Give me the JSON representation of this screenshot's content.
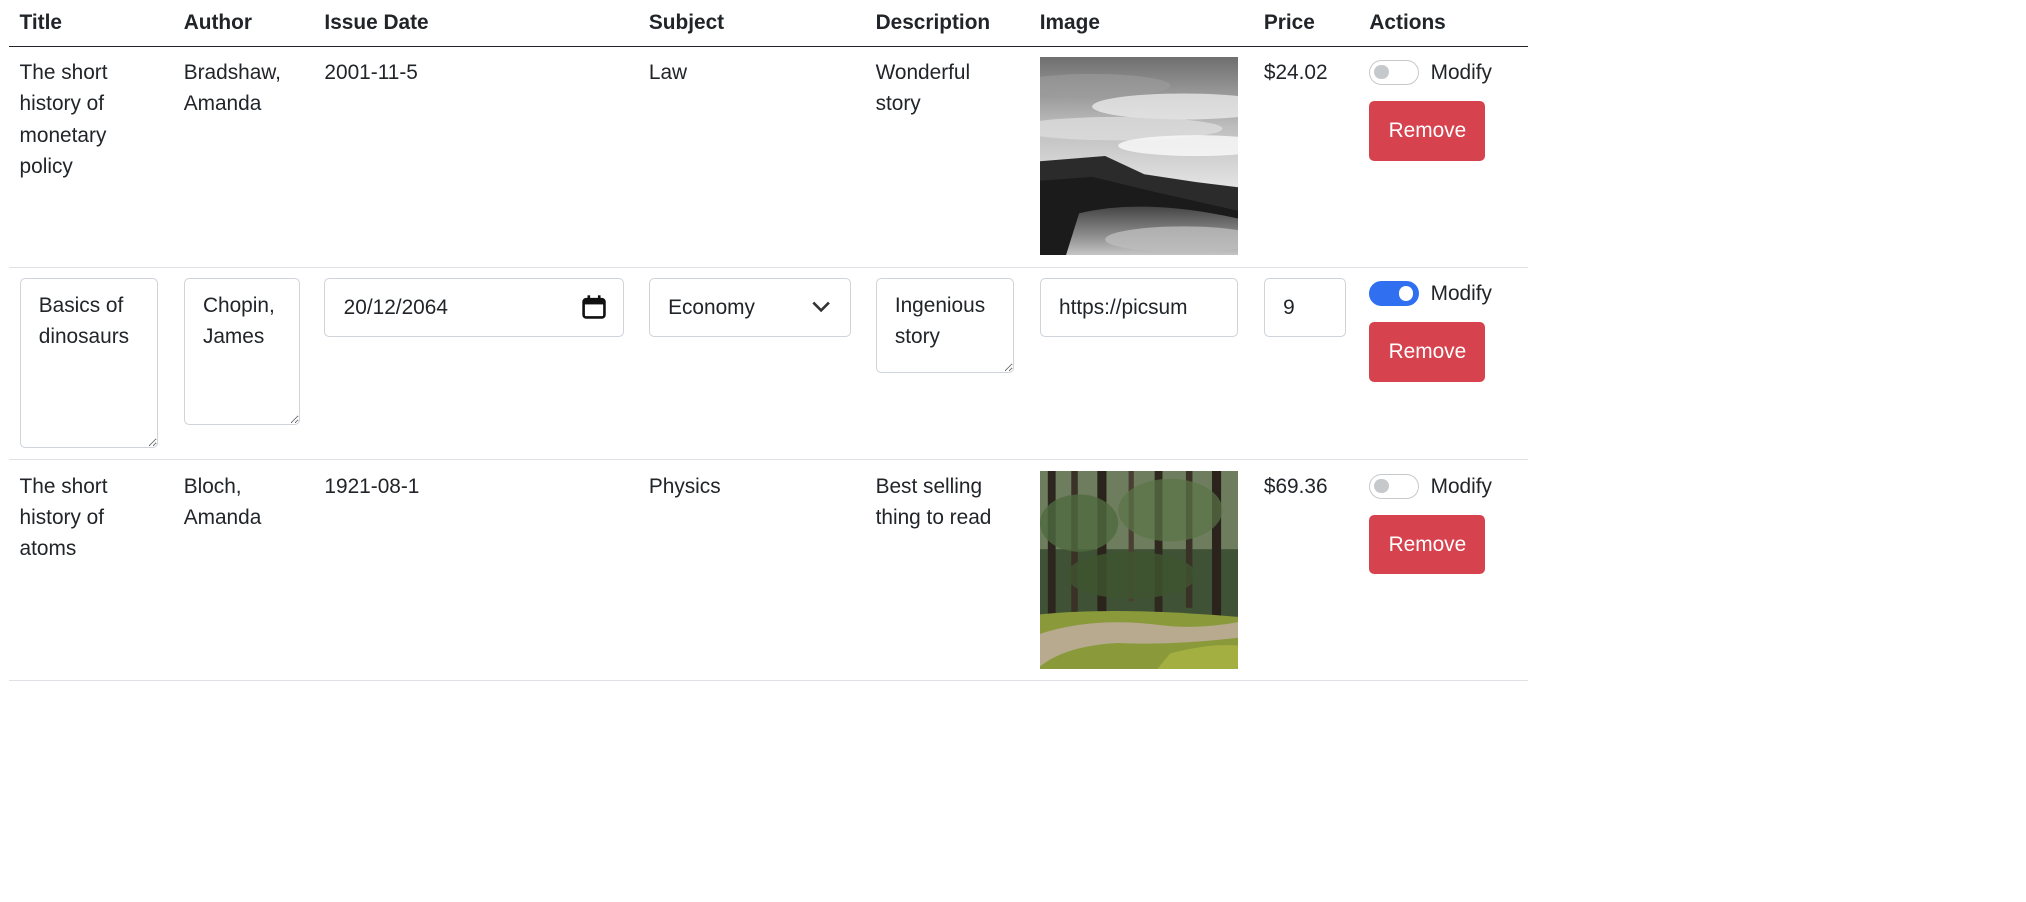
{
  "table": {
    "headers": [
      "Title",
      "Author",
      "Issue Date",
      "Subject",
      "Description",
      "Image",
      "Price",
      "Actions"
    ]
  },
  "rows": [
    {
      "title": "The short history of monetary policy",
      "author": "Bradshaw, Amanda",
      "issue_date": "2001-11-5",
      "subject": "Law",
      "description": "Wonderful story",
      "image_icon": "foggy-hills-image",
      "price": "$24.02",
      "modify_label": "Modify",
      "modify_on": false,
      "remove_label": "Remove"
    },
    {
      "title": "Basics of dinosaurs",
      "author": "Chopin, James",
      "issue_date": "20/12/2064",
      "subject": "Economy",
      "description": "Ingenious story",
      "image_url": "https://picsum",
      "price": "9",
      "modify_label": "Modify",
      "modify_on": true,
      "remove_label": "Remove"
    },
    {
      "title": "The short history of atoms",
      "author": "Bloch, Amanda",
      "issue_date": "1921-08-1",
      "subject": "Physics",
      "description": "Best selling thing to read",
      "image_icon": "forest-path-image",
      "price": "$69.36",
      "modify_label": "Modify",
      "modify_on": false,
      "remove_label": "Remove"
    }
  ],
  "colors": {
    "remove_button": "#d6424d",
    "switch_on": "#2f6ff0",
    "header_rule": "#212529",
    "row_rule": "#dee2e6"
  }
}
